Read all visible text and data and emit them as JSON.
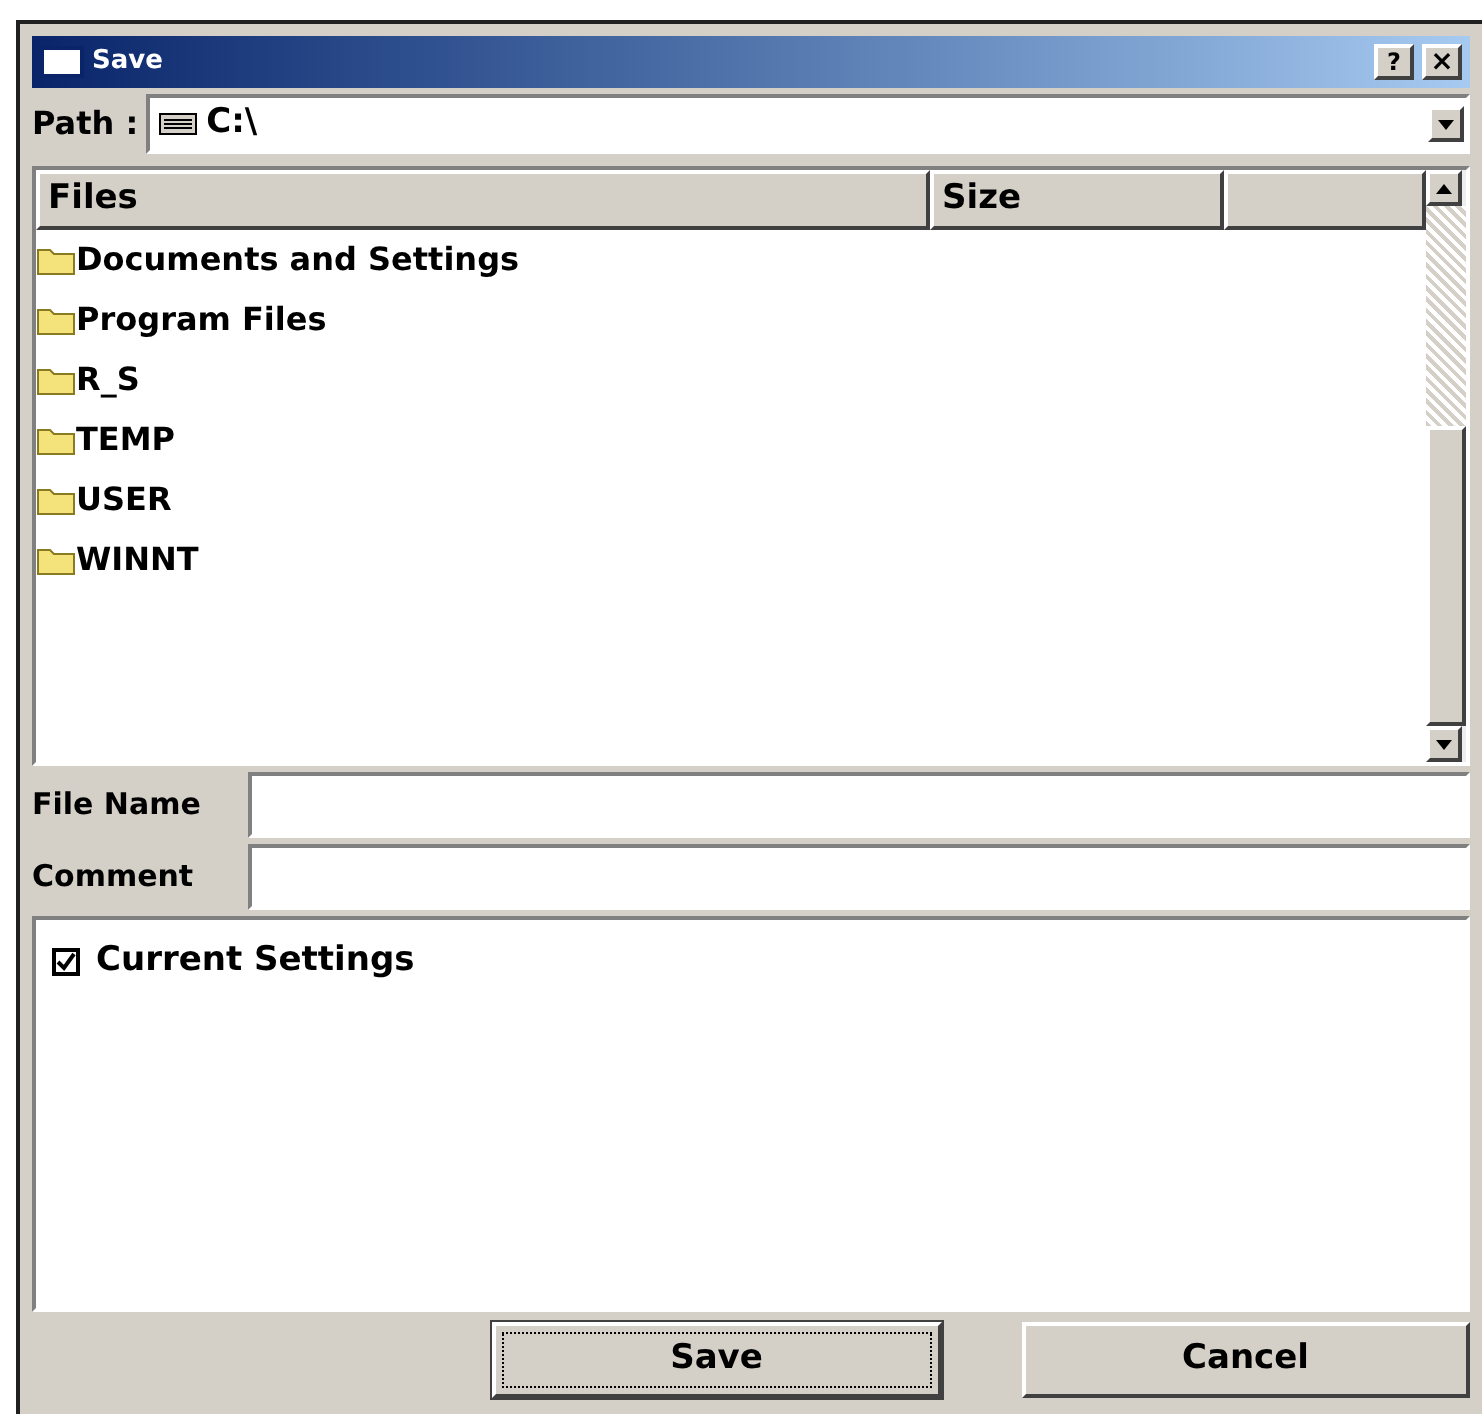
{
  "window": {
    "title": "Save",
    "help": "?",
    "close": "×"
  },
  "path": {
    "label": "Path :",
    "value": "C:\\"
  },
  "files": {
    "columns": [
      "Files",
      "Size"
    ],
    "rows": [
      {
        "name": "Documents and Settings"
      },
      {
        "name": "Program Files"
      },
      {
        "name": "R_S"
      },
      {
        "name": "TEMP"
      },
      {
        "name": "USER"
      },
      {
        "name": "WINNT"
      }
    ]
  },
  "file_name": {
    "label": "File Name"
  },
  "comment": {
    "label": "Comment"
  },
  "items": [
    {
      "label": "Current Settings",
      "checked": true
    }
  ],
  "buttons": [
    {
      "label": "Save",
      "focused": true
    },
    {
      "label": "Cancel",
      "focused": false
    }
  ]
}
